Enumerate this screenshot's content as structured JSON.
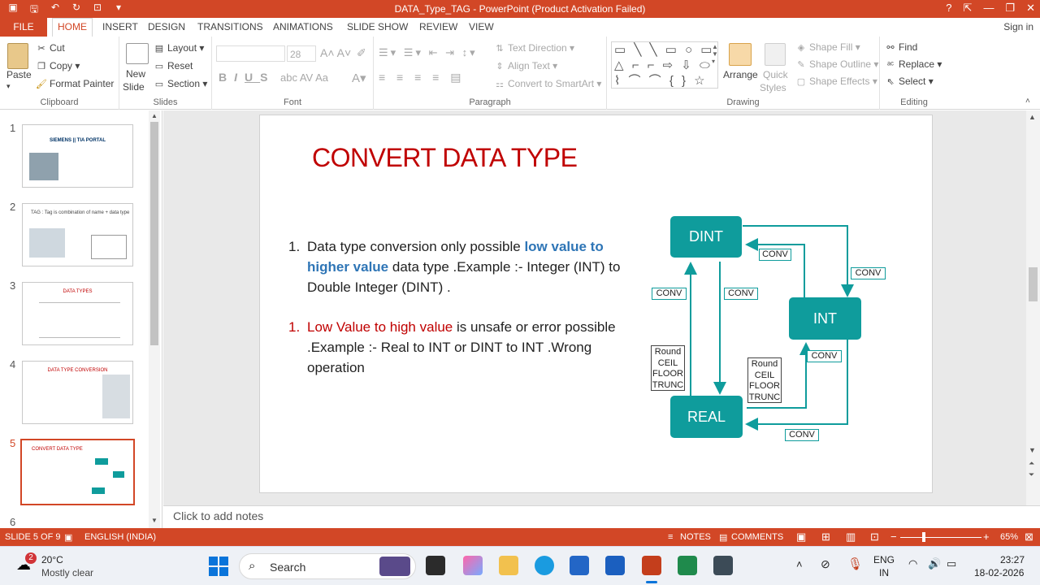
{
  "window": {
    "title": "DATA_Type_TAG  -  PowerPoint (Product Activation Failed)",
    "help": "?"
  },
  "tabs": {
    "file": "FILE",
    "home": "HOME",
    "insert": "INSERT",
    "design": "DESIGN",
    "transitions": "TRANSITIONS",
    "animations": "ANIMATIONS",
    "slide_show": "SLIDE SHOW",
    "review": "REVIEW",
    "view": "VIEW",
    "sign_in": "Sign in"
  },
  "ribbon": {
    "clipboard": {
      "label": "Clipboard",
      "paste": "Paste",
      "cut": "Cut",
      "copy": "Copy",
      "format_painter": "Format Painter"
    },
    "slides": {
      "label": "Slides",
      "new_slide_1": "New",
      "new_slide_2": "Slide",
      "layout": "Layout",
      "reset": "Reset",
      "section": "Section"
    },
    "font": {
      "label": "Font",
      "size": "28"
    },
    "paragraph": {
      "label": "Paragraph",
      "text_direction": "Text Direction",
      "align_text": "Align Text",
      "convert_smartart": "Convert to SmartArt"
    },
    "drawing": {
      "label": "Drawing",
      "arrange": "Arrange",
      "quick_styles_1": "Quick",
      "quick_styles_2": "Styles",
      "shape_fill": "Shape Fill",
      "shape_outline": "Shape Outline",
      "shape_effects": "Shape Effects"
    },
    "editing": {
      "label": "Editing",
      "find": "Find",
      "replace": "Replace",
      "select": "Select"
    }
  },
  "thumbnails": [
    {
      "num": "1",
      "title": "SIEMENS || TIA PORTAL"
    },
    {
      "num": "2",
      "title": "TAG : Tag is combination of name + data type"
    },
    {
      "num": "3",
      "title": "DATA TYPES"
    },
    {
      "num": "4",
      "title": "DATA TYPE CONVERSION"
    },
    {
      "num": "5",
      "title": "CONVERT DATA TYPE"
    },
    {
      "num": "6",
      "title": ""
    }
  ],
  "slide": {
    "title": "CONVERT DATA TYPE",
    "bullet1": {
      "num": "1.",
      "pre": "Data type conversion only possible ",
      "highlight": "low value to higher value",
      "post": " data type .Example :- Integer (INT) to Double Integer (DINT) ."
    },
    "bullet2": {
      "num": "1.",
      "highlight": "Low Value to high value",
      "post": " is unsafe or error possible .Example :- Real to INT or DINT to INT .Wrong operation"
    },
    "diagram": {
      "dint": "DINT",
      "int": "INT",
      "real": "REAL",
      "conv": "CONV",
      "round_lines": [
        "Round",
        "CEIL",
        "FLOOR",
        "TRUNC"
      ]
    }
  },
  "notes": {
    "placeholder": "Click to add notes"
  },
  "status": {
    "slide_of": "SLIDE 5 OF 9",
    "language": "ENGLISH (INDIA)",
    "notes": "NOTES",
    "comments": "COMMENTS",
    "zoom": "65%"
  },
  "taskbar": {
    "weather_temp": "20°C",
    "weather_desc": "Mostly clear",
    "weather_badge": "2",
    "search": "Search",
    "lang1": "ENG",
    "lang2": "IN",
    "time": "23:27",
    "date": "18-02-2026"
  },
  "colors": {
    "accent": "#d24726",
    "slide_red": "#c00000",
    "highlight_blue": "#2e75b6",
    "teal": "#0f9c9c"
  }
}
